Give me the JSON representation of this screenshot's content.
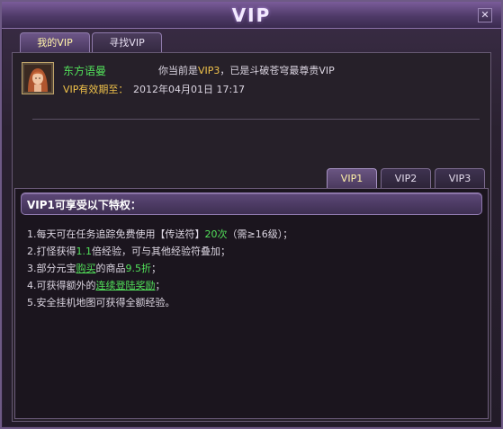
{
  "window": {
    "title": "VIP",
    "close_glyph": "✕"
  },
  "main_tabs": [
    {
      "label": "我的VIP",
      "active": true
    },
    {
      "label": "寻找VIP",
      "active": false
    }
  ],
  "profile": {
    "name": "东方语曼",
    "status_prefix": "你当前是",
    "vip_level": "VIP3",
    "status_suffix": "，已是斗破苍穹最尊贵VIP",
    "expiry_label": "VIP有效期至：",
    "expiry_date": "2012年04月01日 17:17"
  },
  "vip_tabs": [
    {
      "label": "VIP1",
      "active": true
    },
    {
      "label": "VIP2",
      "active": false
    },
    {
      "label": "VIP3",
      "active": false
    }
  ],
  "benefits": {
    "title": "VIP1可享受以下特权：",
    "item1": {
      "a": "1.每天可在任务追踪免费使用【传送符】",
      "b": "20次",
      "c": "（需≥16级）；"
    },
    "item2": {
      "a": "2.打怪获得",
      "b": "1.1",
      "c": "倍经验，可与其他经验符叠加；"
    },
    "item3": {
      "a": "3.部分元宝",
      "b": "购买",
      "c": "的商品",
      "d": "9.5折",
      "e": "；"
    },
    "item4": {
      "a": "4.可获得额外的",
      "b": "连续登陆奖励",
      "c": "；"
    },
    "item5": {
      "a": "5.安全挂机地图可获得全额经验。"
    }
  },
  "colors": {
    "accent_green": "#52e05a",
    "accent_gold": "#f0c24a",
    "frame_purple": "#6e5a86"
  }
}
